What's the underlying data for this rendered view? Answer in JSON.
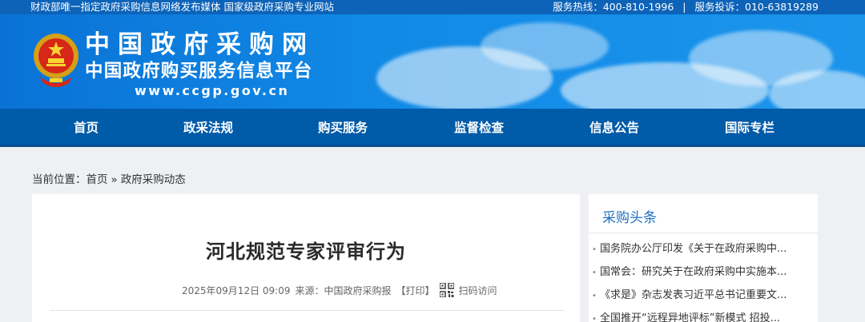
{
  "topbar": {
    "left_text": "财政部唯一指定政府采购信息网络发布媒体 国家级政府采购专业网站",
    "hotline": "服务热线：400-810-1996",
    "separator": "|",
    "complaint": "服务投诉：010-63819289"
  },
  "header": {
    "logo_title": "中国政府采购网",
    "logo_subtitle": "中国政府购买服务信息平台",
    "logo_url": "www.ccgp.gov.cn",
    "emblem_icon": "national-emblem-icon"
  },
  "nav": {
    "items": [
      {
        "label": "首页"
      },
      {
        "label": "政采法规"
      },
      {
        "label": "购买服务"
      },
      {
        "label": "监督检查"
      },
      {
        "label": "信息公告"
      },
      {
        "label": "国际专栏"
      }
    ]
  },
  "breadcrumb": {
    "prefix": "当前位置：",
    "home": "首页",
    "arrow": "»",
    "current": "政府采购动态"
  },
  "article": {
    "title": "河北规范专家评审行为",
    "date": "2025年09月12日 09:09",
    "source": "来源：中国政府采购报",
    "print": "【打印】",
    "qr_label": "扫码访问",
    "qr_icon": "qr-code-icon"
  },
  "sidebar": {
    "title": "采购头条",
    "bullet": "•",
    "items": [
      {
        "text": "国务院办公厅印发《关于在政府采购中..."
      },
      {
        "text": "国常会：研究关于在政府采购中实施本..."
      },
      {
        "text": "《求是》杂志发表习近平总书记重要文..."
      },
      {
        "text": "全国推开“远程异地评标”新模式 招投..."
      }
    ]
  },
  "colors": {
    "topbar_bg": "#0c63b8",
    "banner_bg": "#118ae6",
    "nav_bg": "#005ba8",
    "page_bg": "#eef0f3",
    "side_title": "#1d6fc2"
  }
}
